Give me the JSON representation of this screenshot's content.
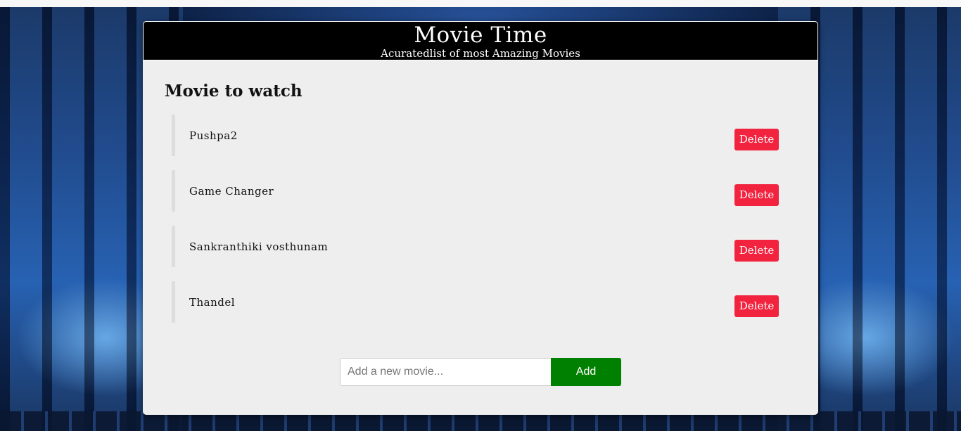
{
  "header": {
    "title": "Movie Time",
    "subtitle": "Acuratedlist of most Amazing Movies"
  },
  "main": {
    "section_title": "Movie to watch",
    "movies": [
      {
        "name": "Pushpa2",
        "delete_label": "Delete"
      },
      {
        "name": "Game Changer",
        "delete_label": "Delete"
      },
      {
        "name": "Sankranthiki vosthunam",
        "delete_label": "Delete"
      },
      {
        "name": "Thandel",
        "delete_label": "Delete"
      }
    ]
  },
  "add_form": {
    "input_value": "",
    "placeholder": "Add a new movie...",
    "add_label": "Add"
  },
  "colors": {
    "header_bg": "#000000",
    "card_bg": "#eeeeee",
    "delete_button": "#f2233f",
    "add_button": "#008000",
    "background": "#1d57a8"
  }
}
